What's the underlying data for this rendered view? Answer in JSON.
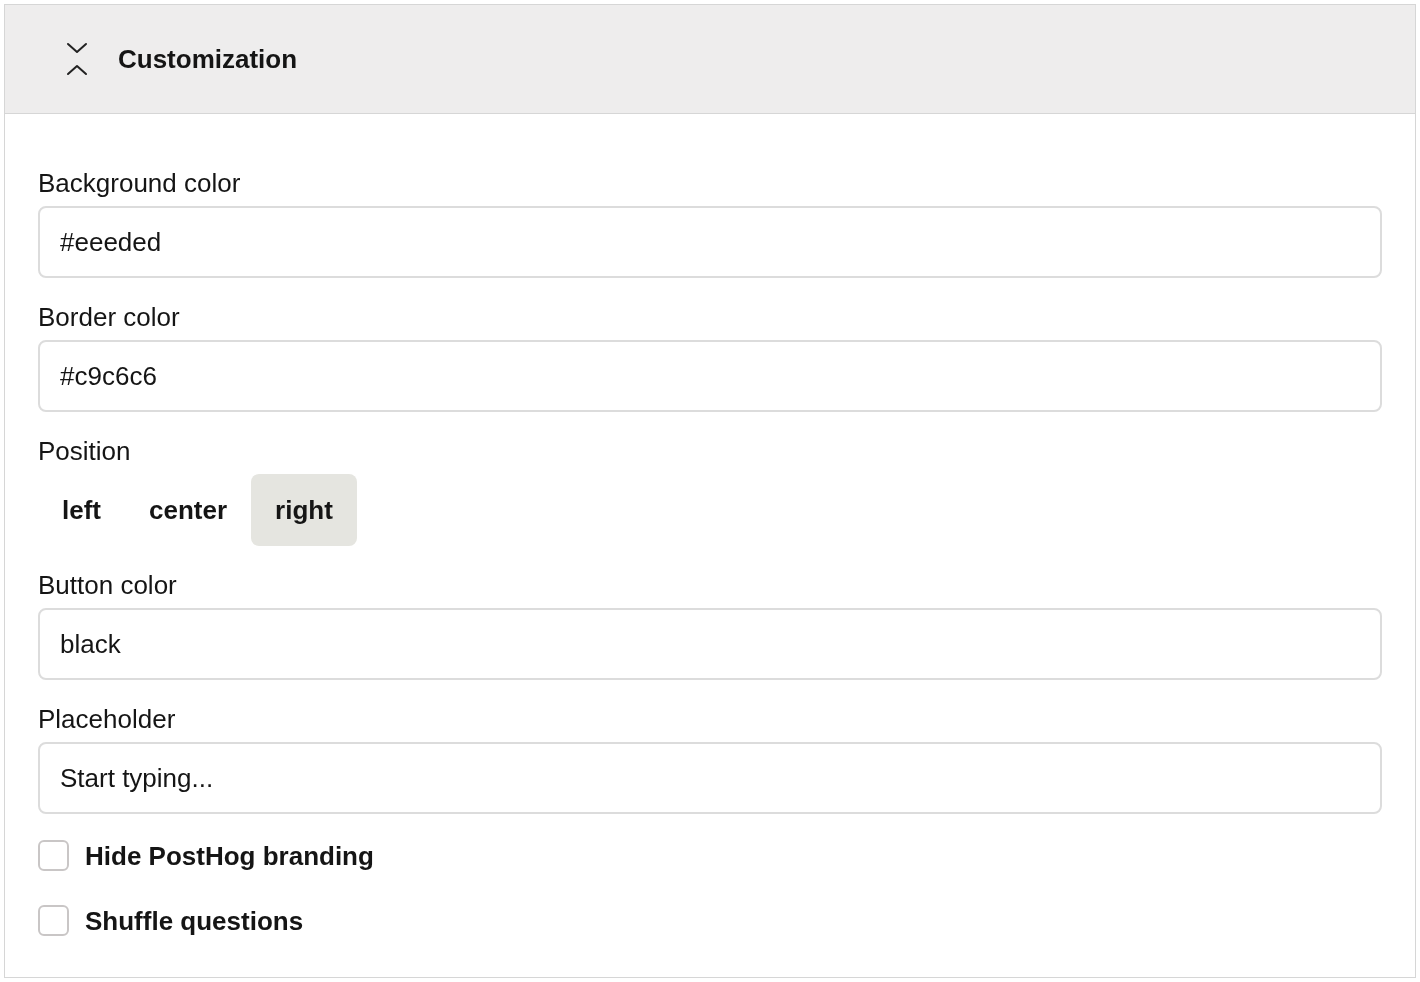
{
  "section": {
    "title": "Customization",
    "expanded": true
  },
  "fields": [
    {
      "kind": "text",
      "label": "Background color",
      "value": "#eeeded"
    },
    {
      "kind": "text",
      "label": "Border color",
      "value": "#c9c6c6"
    },
    {
      "kind": "segmented",
      "label": "Position",
      "options": [
        {
          "label": "left",
          "selected": false
        },
        {
          "label": "center",
          "selected": false
        },
        {
          "label": "right",
          "selected": true
        }
      ]
    },
    {
      "kind": "text",
      "label": "Button color",
      "value": "black"
    },
    {
      "kind": "text",
      "label": "Placeholder",
      "value": "Start typing..."
    }
  ],
  "checkboxes": [
    {
      "label": "Hide PostHog branding",
      "checked": false
    },
    {
      "label": "Shuffle questions",
      "checked": false
    }
  ]
}
